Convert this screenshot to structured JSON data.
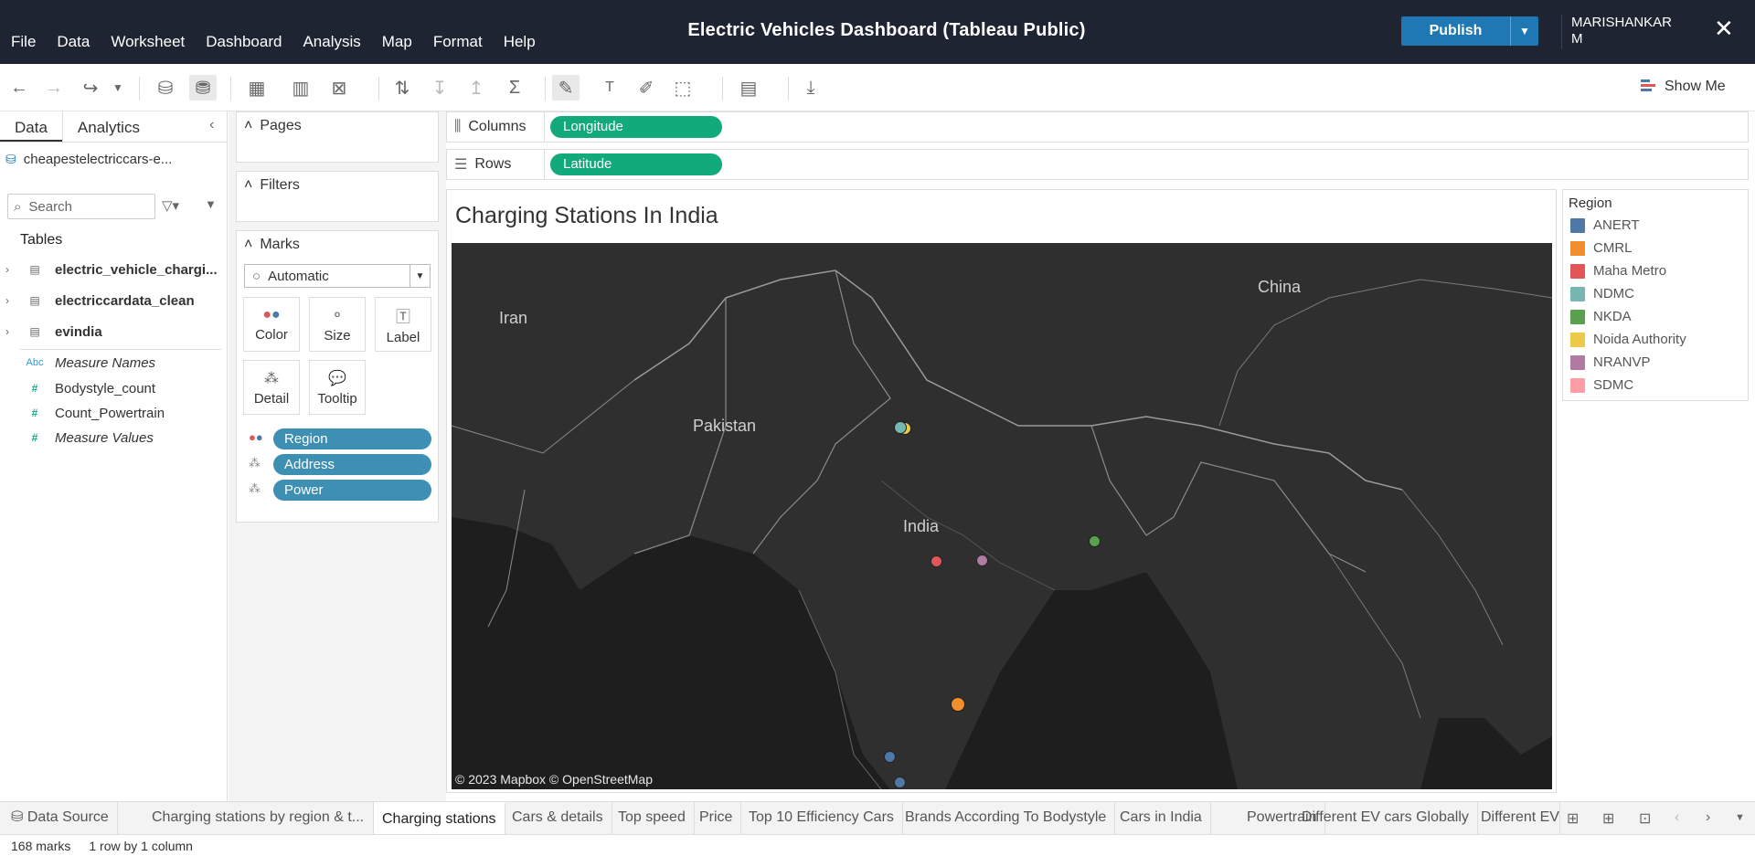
{
  "app": {
    "title": "Electric Vehicles Dashboard (Tableau Public)",
    "menus": [
      "File",
      "Data",
      "Worksheet",
      "Dashboard",
      "Analysis",
      "Map",
      "Format",
      "Help"
    ],
    "publish_label": "Publish",
    "user_line1": "MARISHANKAR",
    "user_line2": "M",
    "show_me_label": "Show Me"
  },
  "data_pane": {
    "tabs": [
      "Data",
      "Analytics"
    ],
    "source": "cheapestelectriccars-e...",
    "search_placeholder": "Search",
    "tables_label": "Tables",
    "tables": [
      "electric_vehicle_chargi...",
      "electriccardata_clean",
      "evindia"
    ],
    "fields": [
      {
        "icon": "Abc",
        "name": "Measure Names",
        "style": "italic"
      },
      {
        "icon": "#",
        "name": "Bodystyle_count",
        "style": "plain"
      },
      {
        "icon": "#",
        "name": "Count_Powertrain",
        "style": "plain"
      },
      {
        "icon": "#",
        "name": "Measure Values",
        "style": "italic"
      }
    ]
  },
  "shelves": {
    "pages_label": "Pages",
    "filters_label": "Filters",
    "marks_label": "Marks",
    "mark_type": "Automatic",
    "mark_buttons": [
      "Color",
      "Size",
      "Label",
      "Detail",
      "Tooltip"
    ],
    "mark_pills": [
      "Region",
      "Address",
      "Power"
    ],
    "columns_label": "Columns",
    "columns_pill": "Longitude",
    "rows_label": "Rows",
    "rows_pill": "Latitude"
  },
  "viz": {
    "title": "Charging Stations In India",
    "copyright": "© 2023 Mapbox  © OpenStreetMap",
    "map_labels": [
      "Iran",
      "Pakistan",
      "India",
      "China"
    ]
  },
  "legend": {
    "title": "Region",
    "items": [
      {
        "name": "ANERT",
        "color": "#4e79a7"
      },
      {
        "name": "CMRL",
        "color": "#f28e2b"
      },
      {
        "name": "Maha Metro",
        "color": "#e15759"
      },
      {
        "name": "NDMC",
        "color": "#76b7b2"
      },
      {
        "name": "NKDA",
        "color": "#59a14f"
      },
      {
        "name": "Noida Authority",
        "color": "#edc948"
      },
      {
        "name": "NRANVP",
        "color": "#b07aa1"
      },
      {
        "name": "SDMC",
        "color": "#ff9da7"
      }
    ]
  },
  "sheets": {
    "tabs": [
      "Data Source",
      "Charging stations by region & t...",
      "Charging stations",
      "Cars & details",
      "Top speed",
      "Price",
      "Top 10 Efficiency Cars",
      "Brands According To Bodystyle",
      "Cars in India",
      "Powertrain",
      "Different EV cars Globally",
      "Different EV"
    ],
    "active": "Charging stations"
  },
  "status": {
    "marks": "168 marks",
    "layout": "1 row by 1 column"
  }
}
